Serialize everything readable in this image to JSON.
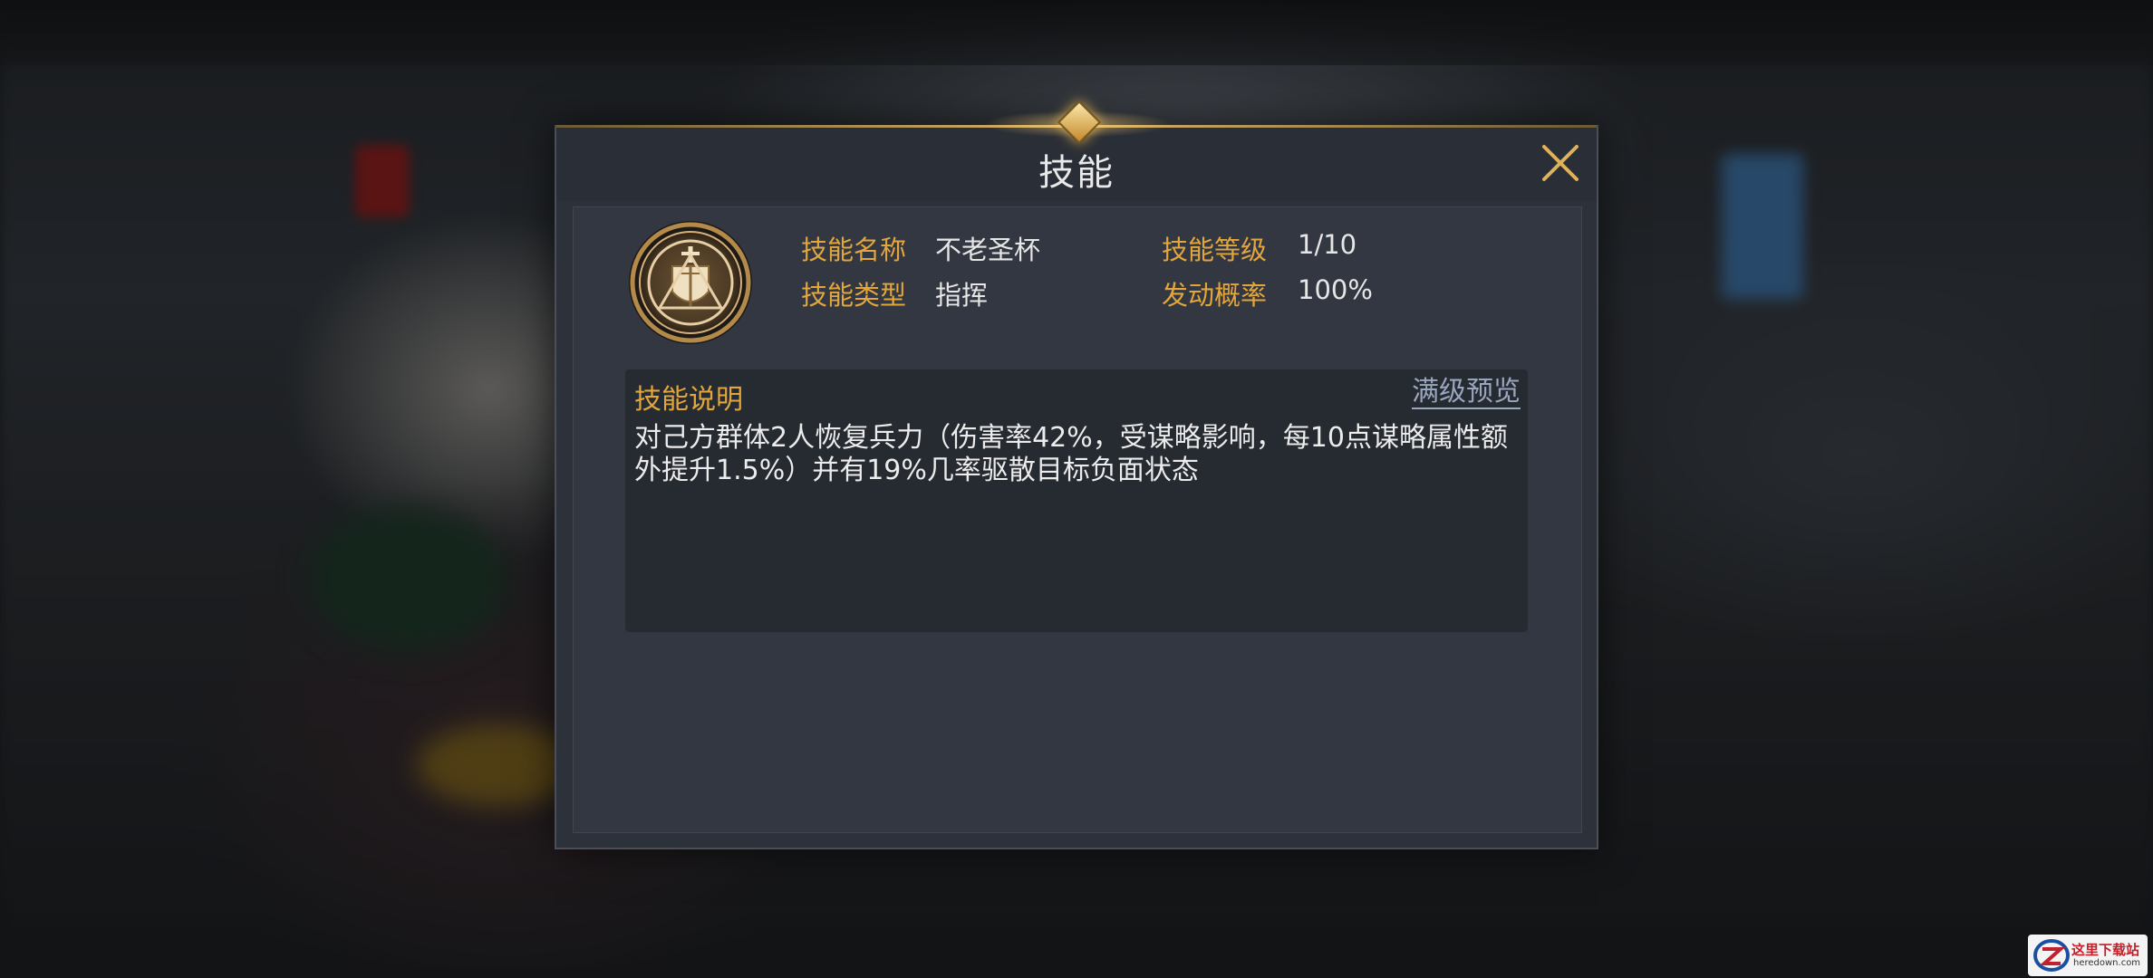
{
  "dialog": {
    "title": "技能",
    "skill_name_label": "技能名称",
    "skill_name_value": "不老圣杯",
    "skill_type_label": "技能类型",
    "skill_type_value": "指挥",
    "skill_level_label": "技能等级",
    "skill_level_value": "1/10",
    "trigger_rate_label": "发动概率",
    "trigger_rate_value": "100%",
    "description_label": "技能说明",
    "max_level_preview": "满级预览",
    "description_text": "对己方群体2人恢复兵力（伤害率42%，受谋略影响，每10点谋略属性额外提升1.5%）并有19%几率驱散目标负面状态"
  },
  "icons": {
    "close": "close-icon",
    "skill": "holy-grail-shield-icon"
  },
  "colors": {
    "accent_gold": "#e2a63c",
    "link": "#9aa6bd",
    "panel": "#2d313a"
  },
  "watermark": {
    "text": "这里下载站",
    "domain": "heredown.com"
  }
}
